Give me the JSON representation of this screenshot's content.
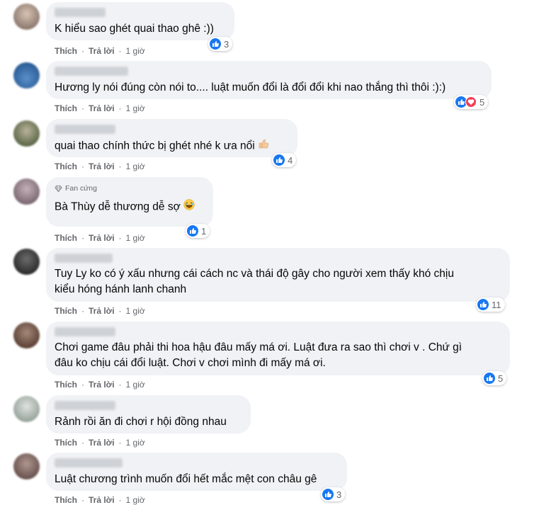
{
  "ui": {
    "like_label": "Thích",
    "reply_label": "Trả lời",
    "dot": "·",
    "time": "1 giờ"
  },
  "comments": [
    {
      "text": "K hiểu sao ghét quai thao ghê :))",
      "reactions": [
        "like"
      ],
      "count": "3"
    },
    {
      "text": "Hương ly nói đúng còn nói to.... luật muốn đổi là đổi đổi khi nao thắng thì thôi :):)",
      "reactions": [
        "like",
        "love"
      ],
      "count": "5"
    },
    {
      "text": "quai thao chính thức bị ghét nhé k ưa nổi",
      "reactions": [
        "like"
      ],
      "count": "4",
      "emoji": "thumbs-up-emoji"
    },
    {
      "badge": "Fan cứng",
      "text": "Bà Thùy dễ thương dễ sợ",
      "reactions": [
        "like"
      ],
      "count": "1",
      "emoji": "laughing-emoji"
    },
    {
      "text": "Tuy Ly ko có ý xấu nhưng cái cách nc và thái độ gây cho người xem thấy khó chịu\nkiểu hóng hánh lanh chanh",
      "reactions": [
        "like"
      ],
      "count": "11"
    },
    {
      "text": "Chơi game đâu phải thi hoa hậu đâu mấy má ơi. Luật đưa ra sao thì chơi v . Chứ gì\nđâu ko chịu cái đổi luật. Chơi v chơi mình đi mấy má ơi.",
      "reactions": [
        "like"
      ],
      "count": "5"
    },
    {
      "text": "Rảnh rồi ăn đi chơi r hội đồng nhau",
      "reactions": [],
      "count": ""
    },
    {
      "text": "Luật chương trình muốn đổi hết mắc mệt con châu gê",
      "reactions": [
        "like"
      ],
      "count": "3"
    }
  ],
  "colors": {
    "bubble": "#f0f2f5",
    "text": "#050505",
    "meta": "#65676b",
    "like_blue": "#1877f2",
    "love_red": "#f33e58"
  }
}
